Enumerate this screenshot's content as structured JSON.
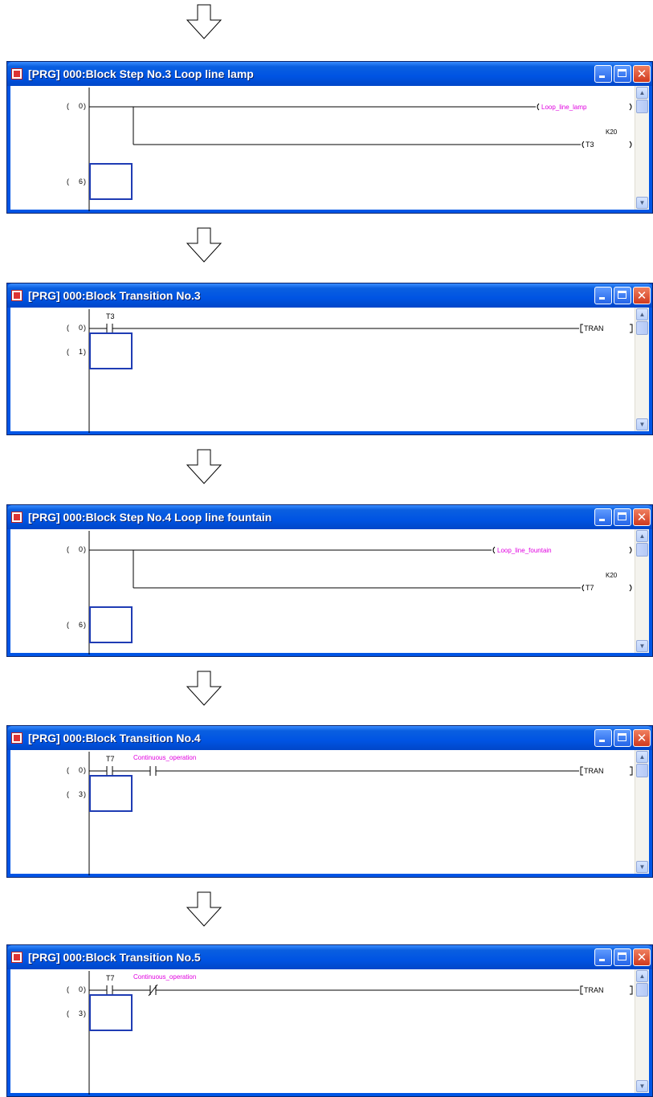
{
  "windows": [
    {
      "title": "[PRG] 000:Block Step No.3 Loop line lamp",
      "steps": [
        "0",
        "6"
      ],
      "labels": {
        "coil1": "Loop_line_lamp",
        "coil2": "T3",
        "const": "K20"
      }
    },
    {
      "title": "[PRG] 000:Block Transition No.3",
      "steps": [
        "0",
        "1"
      ],
      "labels": {
        "contact1": "T3",
        "tran": "TRAN"
      }
    },
    {
      "title": "[PRG] 000:Block Step No.4 Loop line fountain",
      "steps": [
        "0",
        "6"
      ],
      "labels": {
        "coil1": "Loop_line_fountain",
        "coil2": "T7",
        "const": "K20"
      }
    },
    {
      "title": "[PRG] 000:Block Transition No.4",
      "steps": [
        "0",
        "3"
      ],
      "labels": {
        "contact1": "T7",
        "contact2": "Continuous_operation",
        "tran": "TRAN"
      }
    },
    {
      "title": "[PRG] 000:Block Transition No.5",
      "steps": [
        "0",
        "3"
      ],
      "labels": {
        "contact1": "T7",
        "contact2": "Continuous_operation",
        "tran": "TRAN"
      }
    }
  ],
  "colors": {
    "titlebar": "#0054e3",
    "cursor": "#1f3cb4",
    "device_comment": "#e000e0"
  },
  "icons": {
    "arrow": "down-arrow-icon",
    "app": "ladder-app-icon",
    "minimize": "minimize-icon",
    "maximize": "maximize-icon",
    "close": "close-icon"
  }
}
